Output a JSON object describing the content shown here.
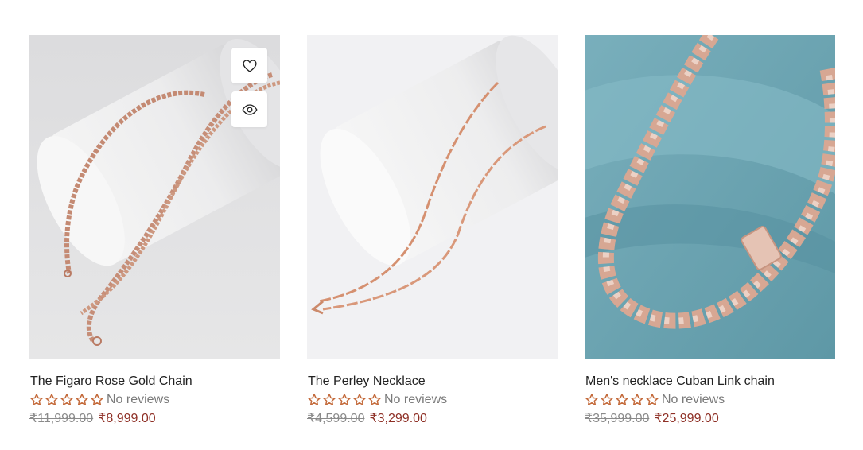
{
  "colors": {
    "star": "#c46b3c",
    "sale_price": "#8e2f25",
    "old_price": "#8a8a8a",
    "card1_bg": "#e2e2e3",
    "card2_bg": "#f1f1f3",
    "card3_bg": "#6fa6b4"
  },
  "icons": {
    "wishlist": "heart-icon",
    "quick_view": "eye-icon",
    "rating_star": "star-outline-icon"
  },
  "products": [
    {
      "title": "The Figaro Rose Gold Chain",
      "reviews": "No reviews",
      "rating": 0,
      "old_price": "₹11,999.00",
      "price": "₹8,999.00"
    },
    {
      "title": "The Perley Necklace",
      "reviews": "No reviews",
      "rating": 0,
      "old_price": "₹4,599.00",
      "price": "₹3,299.00"
    },
    {
      "title": "Men's necklace Cuban Link chain",
      "reviews": "No reviews",
      "rating": 0,
      "old_price": "₹35,999.00",
      "price": "₹25,999.00"
    }
  ]
}
